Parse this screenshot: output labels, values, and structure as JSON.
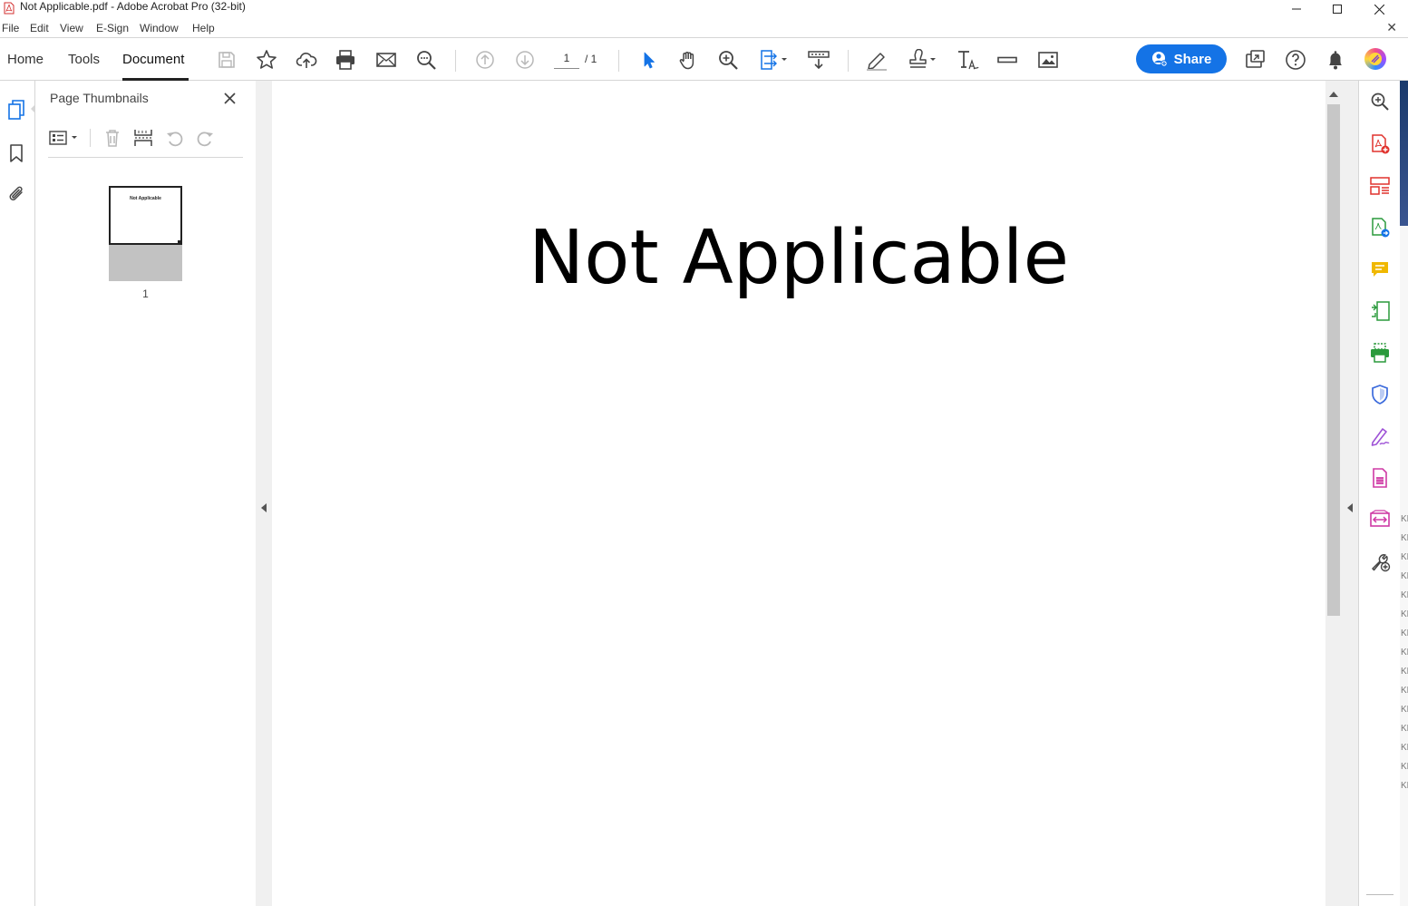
{
  "window": {
    "title": "Not Applicable.pdf - Adobe Acrobat Pro (32-bit)"
  },
  "menu": {
    "items": [
      "File",
      "Edit",
      "View",
      "E-Sign",
      "Window",
      "Help"
    ]
  },
  "toolbar": {
    "tabs": [
      "Home",
      "Tools",
      "Document"
    ],
    "active_tab": "Document",
    "current_page": "1",
    "total_pages": "/ 1",
    "share_label": "Share"
  },
  "thumbnails_panel": {
    "title": "Page Thumbnails",
    "thumbnail_text": "Not Applicable",
    "thumbnail_label": "1"
  },
  "document": {
    "page_text": "Not Applicable"
  },
  "background_strip": {
    "row_marks": [
      "KE",
      "KE",
      "KE",
      "KE",
      "KE",
      "KE",
      "KE",
      "KE",
      "KE",
      "KE",
      "KE",
      "KE",
      "KE",
      "KE",
      "KE"
    ]
  },
  "colors": {
    "accent": "#1473e6",
    "pdf_red": "#e0322d",
    "comment_yellow": "#f0b800",
    "green": "#2a9a3c",
    "protect_blue": "#3c6bdc",
    "sign_purple": "#9e52d6",
    "magenta": "#cf3aa5"
  }
}
